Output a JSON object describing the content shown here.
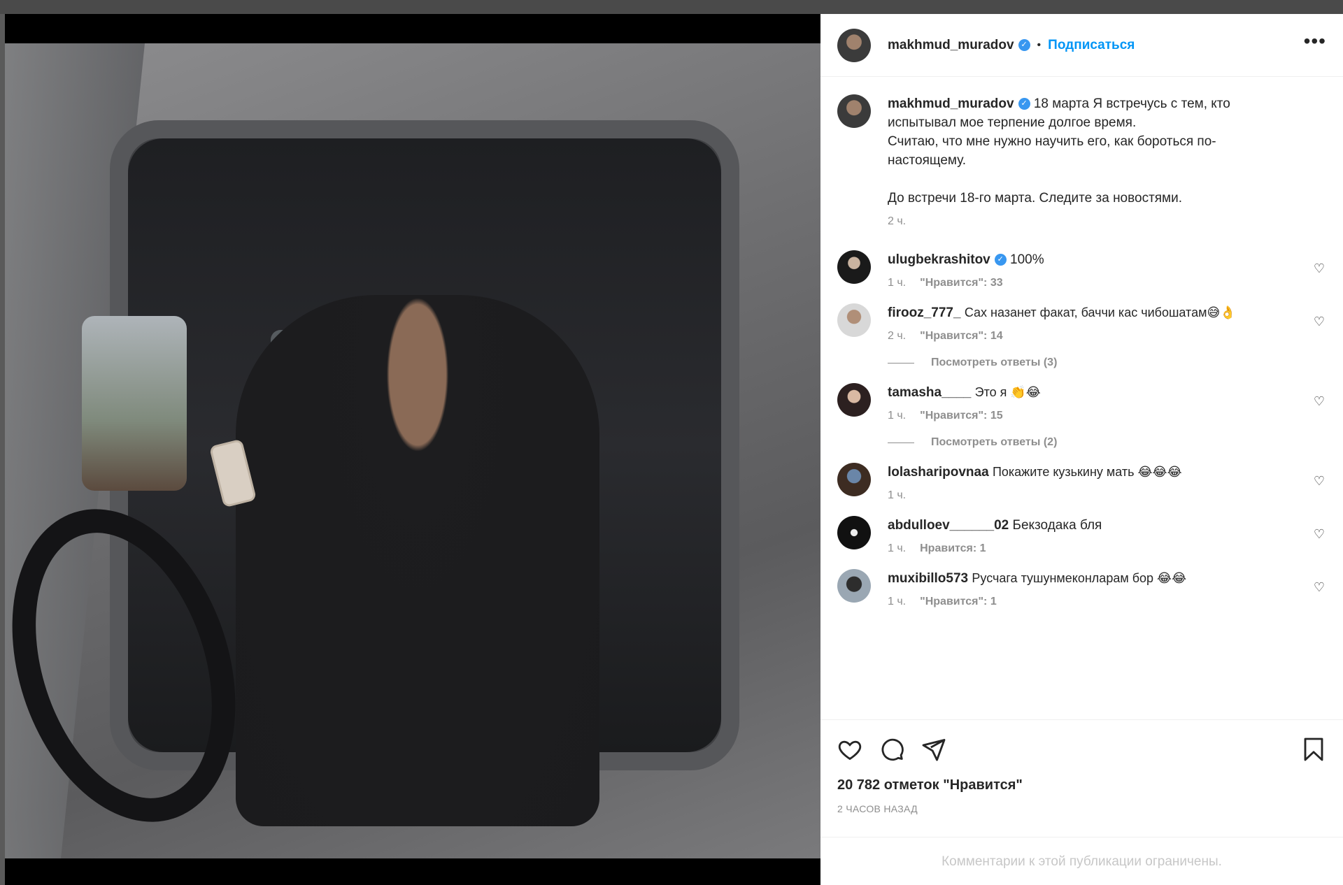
{
  "post": {
    "author": "makhmud_muradov",
    "follow_label": "Подписаться",
    "more_label": "•••",
    "dot": "•",
    "verified_mark": "✓"
  },
  "caption": {
    "username": "makhmud_muradov",
    "text": "18 марта Я встречусь с тем, кто испытывал мое терпение долгое время.",
    "text2": "Считаю, что мне нужно научить его, как бороться по-настоящему.",
    "text3": "До встречи 18-го марта. Следите за новостями.",
    "time": "2 ч."
  },
  "comments": [
    {
      "username": "ulugbekrashitov",
      "verified": true,
      "text": "100%",
      "time": "1 ч.",
      "likes": "\"Нравится\": 33"
    },
    {
      "username": "firooz_777_",
      "verified": false,
      "text": "Сах назанет факат, баччи кас чибошатам😅👌",
      "time": "2 ч.",
      "likes": "\"Нравится\": 14",
      "replies": "Посмотреть ответы (3)"
    },
    {
      "username": "tamasha____",
      "verified": false,
      "text": "Это я 👏😂",
      "time": "1 ч.",
      "likes": "\"Нравится\": 15",
      "replies": "Посмотреть ответы (2)"
    },
    {
      "username": "lolasharipovnaa",
      "verified": false,
      "text": "Покажите кузькину мать 😂😂😂",
      "time": "1 ч.",
      "likes": ""
    },
    {
      "username": "abdulloev______02",
      "verified": false,
      "text": "Бекзодака бля",
      "time": "1 ч.",
      "likes": "Нравится: 1"
    },
    {
      "username": "muxibillo573",
      "verified": false,
      "text": "Русчага тушунмеконларам бор 😂😂",
      "time": "1 ч.",
      "likes": "\"Нравится\": 1"
    }
  ],
  "actions": {
    "likes": "20 782 отметок \"Нравится\"",
    "ago": "2 часов назад"
  },
  "footer": "Комментарии к этой публикации ограничены.",
  "colors": {
    "accent": "#0095f6",
    "verified": "#3897f0",
    "muted": "#8e8e8e"
  }
}
